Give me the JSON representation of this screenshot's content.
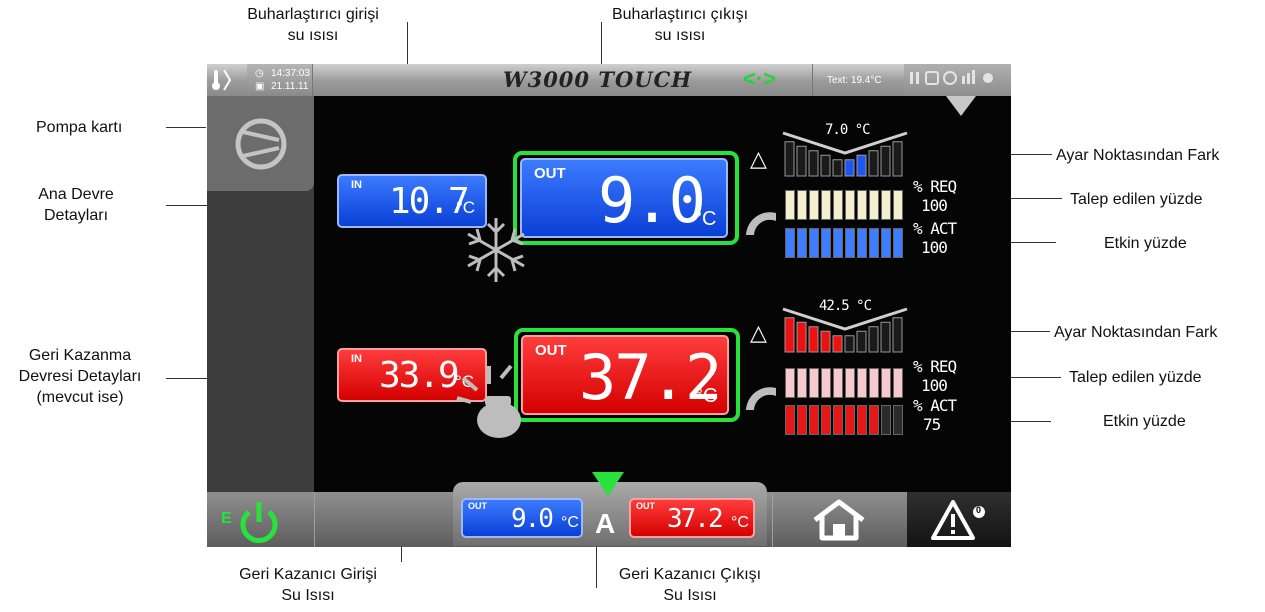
{
  "annotations": {
    "evap_in": "Buharlaştırıcı girişi\nsu ısısı",
    "evap_out": "Buharlaştırıcı çıkışı\nsu ısısı",
    "pump_card": "Pompa kartı",
    "main_circuit": "Ana Devre\nDetayları",
    "recovery_circuit": "Geri Kazanma\nDevresi Detayları\n(mevcut ise)",
    "setpoint_diff_1": "Ayar Noktasından Fark",
    "requested_pct_1": "Talep edilen yüzde",
    "actual_pct_1": "Etkin yüzde",
    "setpoint_diff_2": "Ayar Noktasından Fark",
    "requested_pct_2": "Talep edilen yüzde",
    "actual_pct_2": "Etkin yüzde",
    "recovery_in": "Geri Kazanıcı Girişi\nSu Isısı",
    "recovery_out": "Geri Kazanıcı Çıkışı\nSu Isısı"
  },
  "topbar": {
    "time": "14:37:03",
    "date": "21.11.11",
    "logo": "W3000 TOUCH",
    "text_temp": "Text: 19.4°C"
  },
  "main": {
    "in_label": "IN",
    "in_value": "10.7",
    "out_label": "OUT",
    "out_value": "9.0",
    "unit": "°C",
    "setpoint": "7.0 °C",
    "req_label": "% REQ",
    "req_value": "100",
    "act_label": "% ACT",
    "act_value": "100",
    "req_level": 1.0,
    "act_level": 1.0
  },
  "recovery": {
    "in_label": "IN",
    "in_value": "33.9",
    "out_label": "OUT",
    "out_value": "37.2",
    "unit": "°C",
    "setpoint": "42.5 °C",
    "req_label": "% REQ",
    "req_value": "100",
    "act_label": "% ACT",
    "act_value": "75",
    "req_level": 1.0,
    "act_level": 0.75
  },
  "bottom": {
    "out_label_1": "OUT",
    "out_value_1": "9.0",
    "out_label_2": "OUT",
    "out_value_2": "37.2",
    "unit": "°C",
    "mode": "A",
    "power_prefix": "E",
    "alarm_count": "0"
  },
  "colors": {
    "accent_green": "#27e23a",
    "blue": "#1e56f0",
    "red": "#ee1111"
  }
}
